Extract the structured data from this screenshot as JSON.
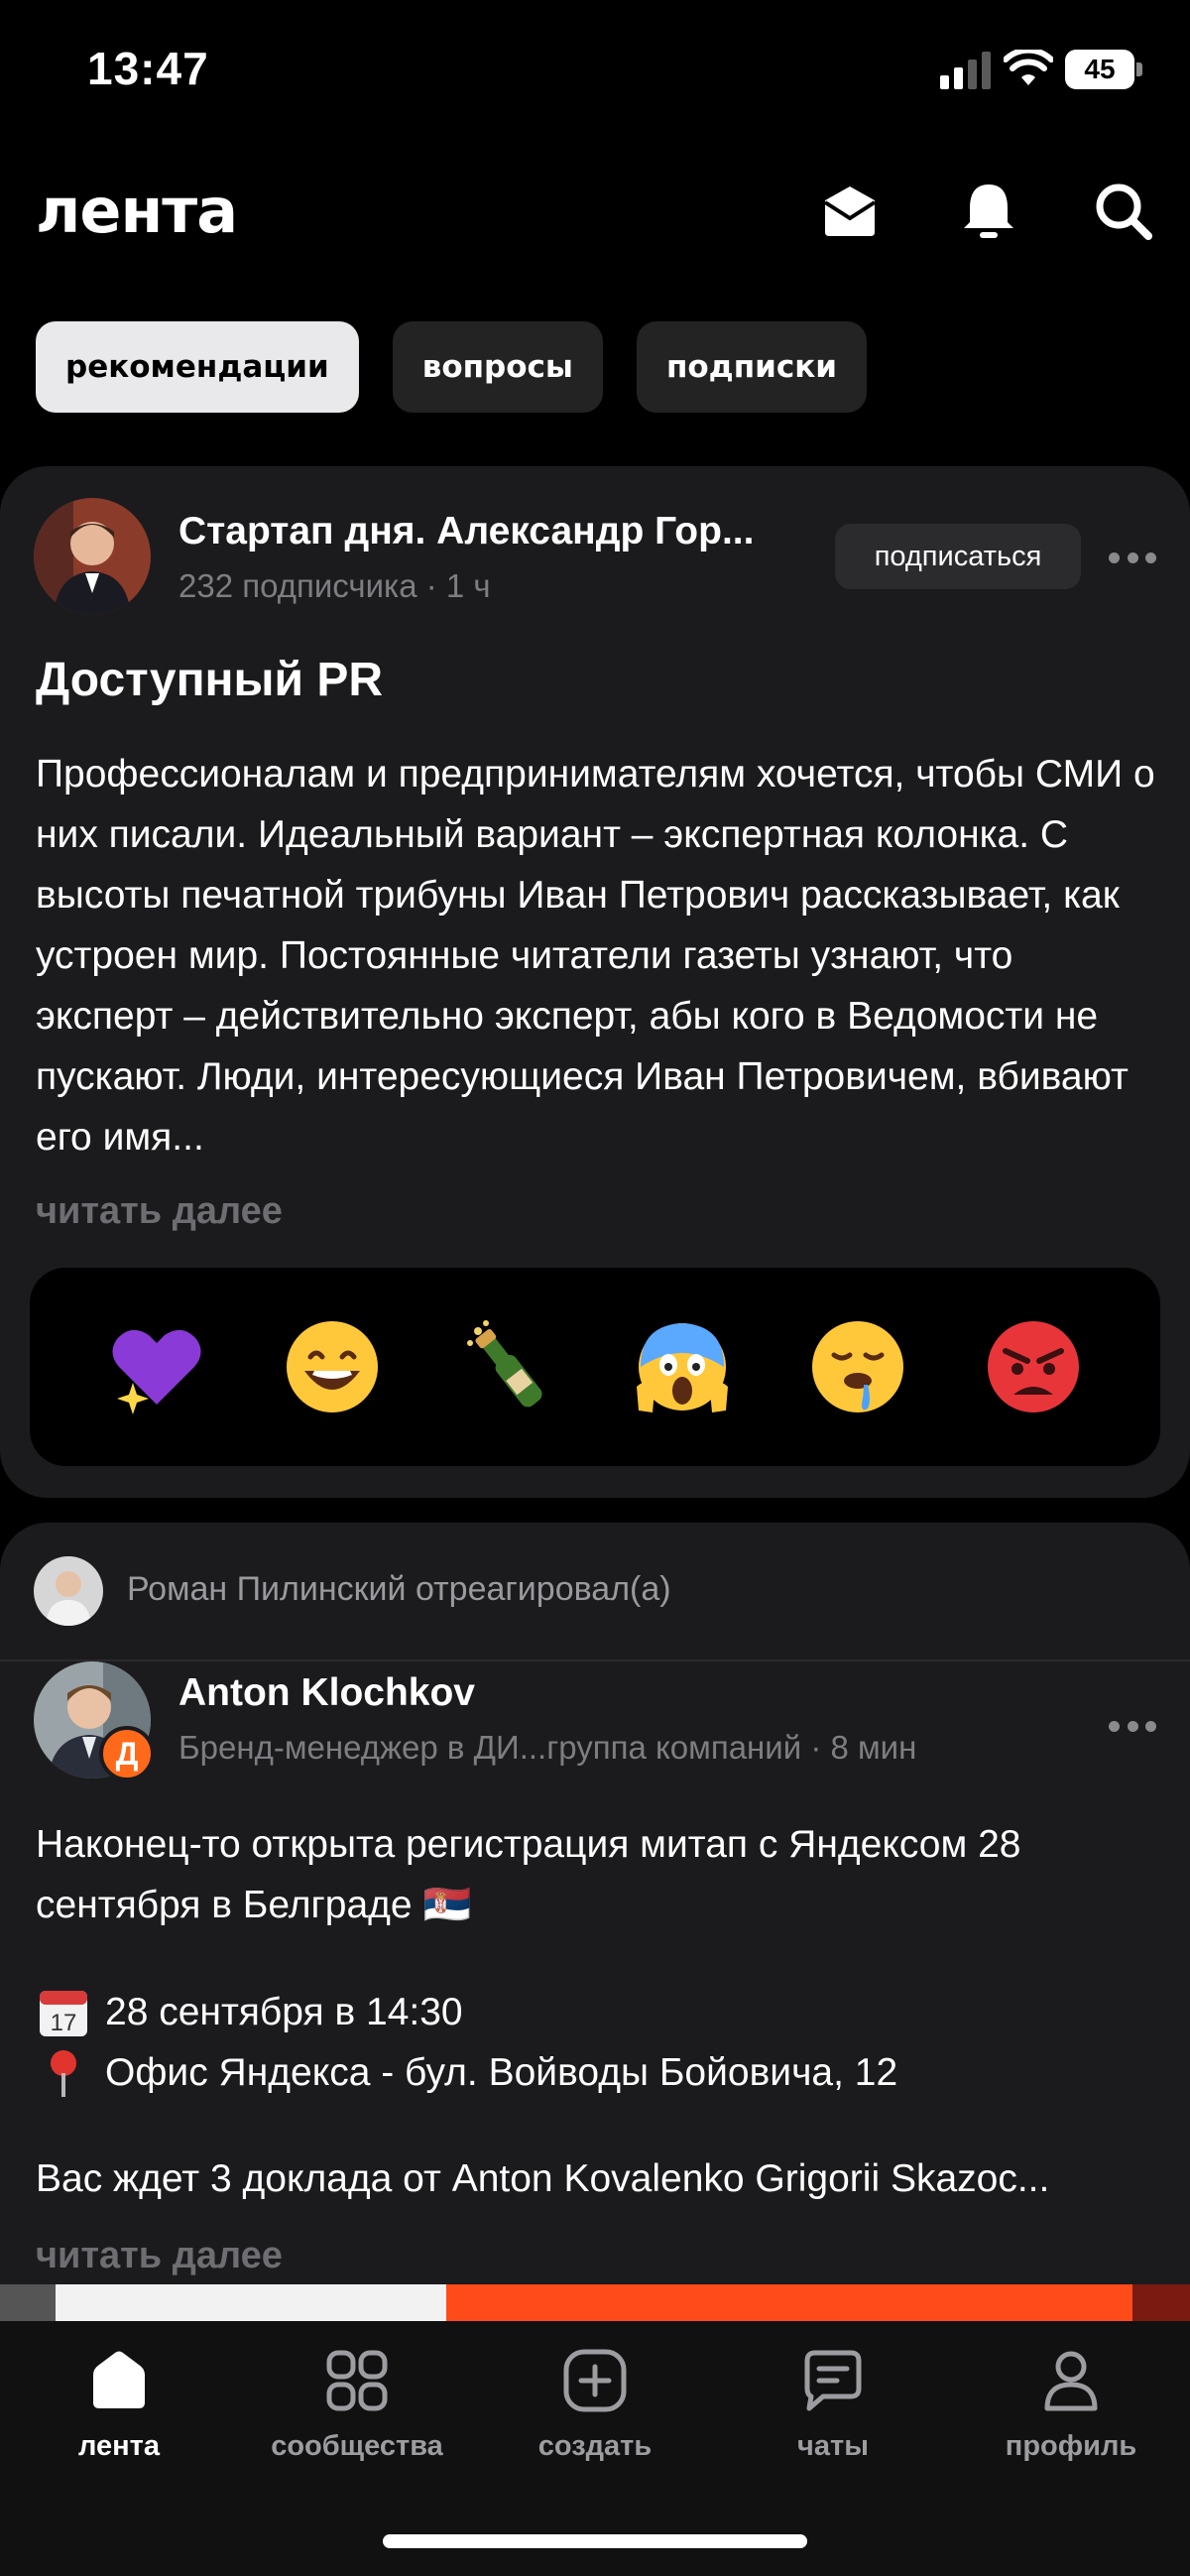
{
  "status_bar": {
    "time": "13:47",
    "battery": "45"
  },
  "header": {
    "logo": "лента"
  },
  "tabs": [
    {
      "label": "рекомендации",
      "active": true
    },
    {
      "label": "вопросы",
      "active": false
    },
    {
      "label": "подписки",
      "active": false
    }
  ],
  "post1": {
    "author": "Стартап дня. Александр Гор...",
    "meta": "232 подписчика · 1 ч",
    "subscribe_label": "подписаться",
    "title": "Доступный PR",
    "body": "Профессионалам и предпринимателям хочется, чтобы СМИ о них писали. Идеальный вариант – экспертная колонка. С высоты печатной трибуны Иван Петрович рассказывает, как устроен мир. Постоянные читатели газеты узнают, что эксперт – действительно эксперт, абы кого в Ведомости не пускают. Люди, интересующиеся Иван Петровичем, вбивают его имя...",
    "read_more": "читать далее",
    "reactions": [
      "purple-heart-icon",
      "grinning-face-icon",
      "champagne-bottle-icon",
      "screaming-face-icon",
      "drooling-face-icon",
      "angry-face-icon"
    ]
  },
  "post2": {
    "reacted_by": "Роман Пилинский отреагировал(а)",
    "author": "Anton Klochkov",
    "meta": "Бренд-менеджер в ДИ...группа компаний · 8 мин",
    "badge": "Д",
    "line1": "Наконец-то открыта регистрация митап с Яндексом 28 сентября в Белграде 🇷🇸",
    "line2": "28 сентября в 14:30",
    "line3": "Офис Яндекса - бул. Войводы Бойовича, 12",
    "line4": "Вас ждет 3 доклада от Anton Kovalenko  Grigorii Skazoc...",
    "read_more": "читать далее"
  },
  "nav": [
    {
      "label": "лента",
      "icon": "home-icon",
      "active": true
    },
    {
      "label": "сообщества",
      "icon": "grid-icon",
      "active": false
    },
    {
      "label": "создать",
      "icon": "plus-square-icon",
      "active": false
    },
    {
      "label": "чаты",
      "icon": "chat-icon",
      "active": false
    },
    {
      "label": "профиль",
      "icon": "profile-icon",
      "active": false
    }
  ],
  "colors": {
    "background": "#000000",
    "card": "#1b1b1d",
    "accent_orange": "#ff6a1a",
    "muted": "#7e7e82"
  }
}
